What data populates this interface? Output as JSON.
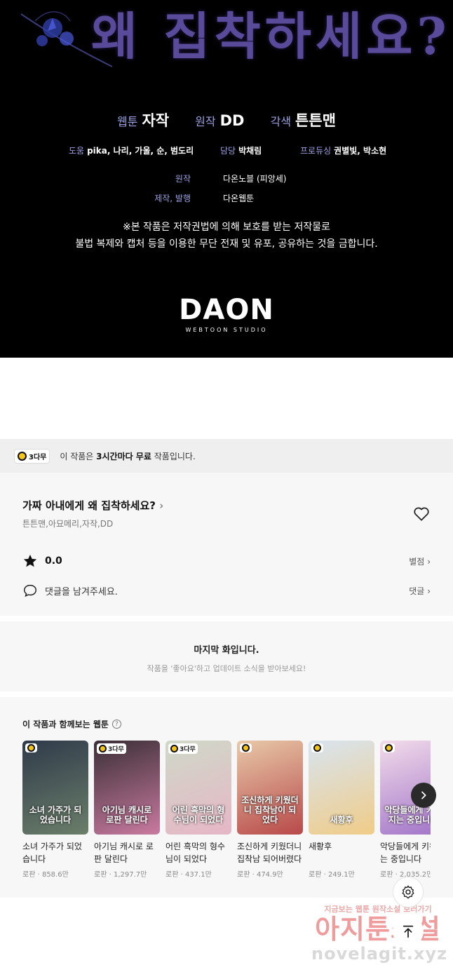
{
  "credits": {
    "title_art": "왜 집착하세요?",
    "main": [
      {
        "key": "웹툰",
        "value": "자작"
      },
      {
        "key": "원작",
        "value": "DD"
      },
      {
        "key": "각색",
        "value": "튼튼맨"
      }
    ],
    "sub": [
      {
        "key": "도움",
        "value": "pika, 나리, 가울, 순, 범도리"
      },
      {
        "key": "담당",
        "value": "박채림"
      },
      {
        "key": "프로듀싱",
        "value": "권별빛, 박소현"
      }
    ],
    "original_key": "원작",
    "original_value": "다온노블 (피앙세)",
    "production_key": "제작, 발행",
    "production_value": "다온웹툰",
    "notice_line1": "※본 작품은 저작권법에 의해 보호를 받는 저작물로",
    "notice_line2": "불법 복제와 캡처 등을 이용한 무단 전재 및 유포, 공유하는 것을 금합니다.",
    "logo_main": "DAON",
    "logo_sub": "WEBTOON STUDIO"
  },
  "free_banner": {
    "badge": "3다무",
    "text_prefix": "이 작품은 ",
    "text_bold": "3시간마다 무료",
    "text_suffix": " 작품입니다."
  },
  "info": {
    "title": "가짜 아내에게 왜 집착하세요?",
    "authors": "튼튼맨,아묘메리,자작,DD",
    "rating": "0.0",
    "rating_link": "별점",
    "comment_prompt": "댓글을 남겨주세요.",
    "comment_link": "댓글"
  },
  "last_episode": {
    "title": "마지막 화입니다.",
    "subtitle": "작품을 '좋아요'하고 업데이트 소식을 받아보세요!"
  },
  "recommendations": {
    "heading": "이 작품과 함께보는 웹툰",
    "help_icon": "?",
    "items": [
      {
        "title": "소녀 가주가 되었습니다",
        "genre": "로판",
        "views": "858.6만",
        "badge": "",
        "cover_text": "소녀 가주가 되었습니다",
        "color1": "#2f3a4a",
        "color2": "#6b7f6a"
      },
      {
        "title": "아기님 캐시로 로판 달린다",
        "genre": "로판",
        "views": "1,297.7만",
        "badge": "3다무",
        "cover_text": "아기님 캐시로 로판 달린다",
        "color1": "#3a2f36",
        "color2": "#c97aa0"
      },
      {
        "title": "어린 흑막의 형수님이 되었다",
        "genre": "로판",
        "views": "437.1만",
        "badge": "3다무",
        "cover_text": "어린 흑막의 형수님이 되었다",
        "color1": "#cfd9c8",
        "color2": "#e6b6c6"
      },
      {
        "title": "조신하게 키웠더니 집착남 되어버렸다",
        "genre": "로판",
        "views": "474.9만",
        "badge": "",
        "cover_text": "조신하게 키웠더니 집착남이 되었다",
        "color1": "#e8c9a8",
        "color2": "#b8494a"
      },
      {
        "title": "새황후",
        "genre": "로판",
        "views": "249.1만",
        "badge": "",
        "cover_text": "새황후",
        "color1": "#d8e4f0",
        "color2": "#f0cc88"
      },
      {
        "title": "악당들에게 키워지는 중입니다",
        "genre": "로판",
        "views": "2,035.2만",
        "badge": "",
        "cover_text": "악당들에게 키워지는 중입니다",
        "color1": "#f3dcea",
        "color2": "#a073c8"
      }
    ]
  },
  "watermark": {
    "top": "지금보는 웹툰 원작소설 보러가기",
    "mid": "아지툰소설",
    "bot": "novelagit.xyz"
  }
}
